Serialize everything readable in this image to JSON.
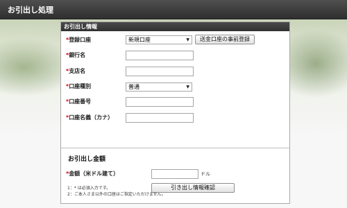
{
  "window": {
    "title": "お引出し処理"
  },
  "panel": {
    "header": "お引出し情報"
  },
  "form": {
    "account": {
      "required_mark": "*",
      "label": "登録口座",
      "selected": "新規口座",
      "register_button": "送金口座の事前登録"
    },
    "bank_name": {
      "required_mark": "*",
      "label": "銀行名",
      "value": ""
    },
    "branch_name": {
      "required_mark": "*",
      "label": "支店名",
      "value": ""
    },
    "account_type": {
      "required_mark": "*",
      "label": "口座種別",
      "selected": "普通"
    },
    "account_number": {
      "required_mark": "*",
      "label": "口座番号",
      "value": ""
    },
    "account_holder": {
      "required_mark": "*",
      "label": "口座名義（カナ）",
      "value": ""
    }
  },
  "amount_section": {
    "title": "お引出し金額",
    "amount": {
      "required_mark": "*",
      "label": "金額（米ドル建て）",
      "value": "",
      "unit": "ドル"
    }
  },
  "notes": [
    "1：* は必須入力です。",
    "2：ご本人さま以外の口座はご指定いただけません。"
  ],
  "actions": {
    "confirm_button": "引き出し情報確認"
  },
  "colors": {
    "title_bar": "#3a3a3a",
    "panel_header": "#3c3c3c",
    "required": "#d40000"
  }
}
